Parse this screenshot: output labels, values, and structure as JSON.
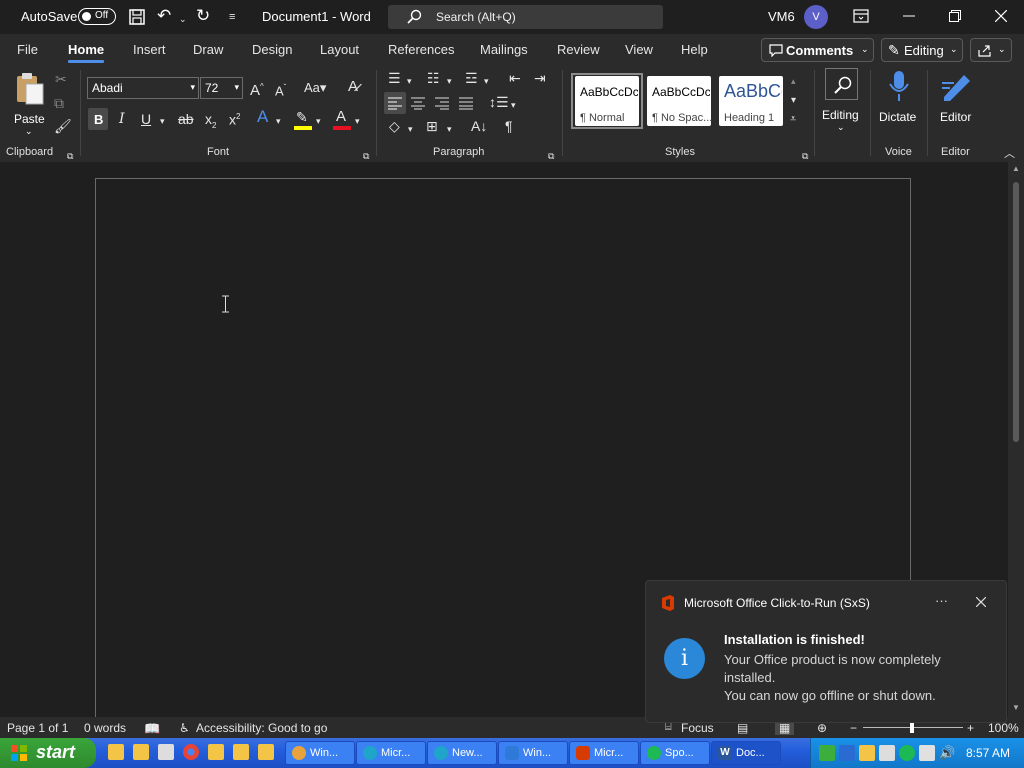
{
  "titlebar": {
    "autosave_label": "AutoSave",
    "autosave_state": "Off",
    "doc_title": "Document1 - Word",
    "search_placeholder": "Search (Alt+Q)",
    "user_initials": "VM6",
    "avatar_letter": "V"
  },
  "tabs": [
    "File",
    "Home",
    "Insert",
    "Draw",
    "Design",
    "Layout",
    "References",
    "Mailings",
    "Review",
    "View",
    "Help"
  ],
  "active_tab": "Home",
  "top_buttons": {
    "comments": "Comments",
    "editing": "Editing"
  },
  "ribbon": {
    "clipboard": {
      "paste": "Paste",
      "label": "Clipboard"
    },
    "font": {
      "name": "Abadi",
      "size": "72",
      "label": "Font"
    },
    "paragraph": {
      "label": "Paragraph"
    },
    "styles": {
      "label": "Styles",
      "items": [
        {
          "preview": "AaBbCcDc",
          "name": "¶ Normal"
        },
        {
          "preview": "AaBbCcDc",
          "name": "¶ No Spac..."
        },
        {
          "preview": "AaBbCc",
          "name": "Heading 1"
        }
      ]
    },
    "editing_label": "Editing",
    "voice": {
      "button": "Dictate",
      "label": "Voice"
    },
    "editor": {
      "button": "Editor",
      "label": "Editor"
    }
  },
  "statusbar": {
    "page": "Page 1 of 1",
    "words": "0 words",
    "accessibility": "Accessibility: Good to go",
    "focus": "Focus",
    "zoom": "100%"
  },
  "toast": {
    "app": "Microsoft Office Click-to-Run (SxS)",
    "heading": "Installation is finished!",
    "line1": "Your Office product is now completely installed.",
    "line2": "You can now go offline or shut down."
  },
  "taskbar": {
    "start": "start",
    "tasks": [
      {
        "label": "Win...",
        "icon": "chrome-icon",
        "color": "#e8a33d"
      },
      {
        "label": "Micr...",
        "icon": "edge-icon",
        "color": "#1ea5c9"
      },
      {
        "label": "New...",
        "icon": "edge-icon",
        "color": "#1ea5c9"
      },
      {
        "label": "Win...",
        "icon": "defender-icon",
        "color": "#2f7ad8"
      },
      {
        "label": "Micr...",
        "icon": "office-icon",
        "color": "#d83b01"
      },
      {
        "label": "Spo...",
        "icon": "spotify-icon",
        "color": "#1db954"
      },
      {
        "label": "Doc...",
        "icon": "word-icon",
        "color": "#2b579a"
      }
    ],
    "clock": "8:57 AM"
  },
  "colors": {
    "accent": "#4f8ee8",
    "toast_info": "#2b88d8",
    "font_color_bar": "#e81123",
    "highlight_bar": "#ffff00"
  }
}
